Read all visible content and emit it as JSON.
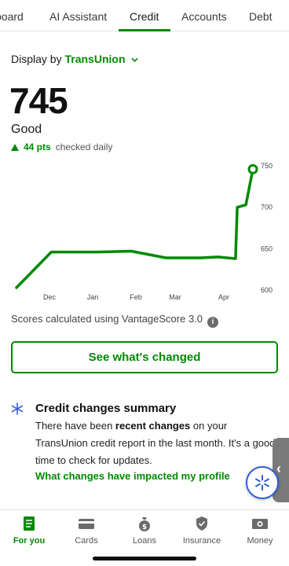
{
  "tabs": [
    {
      "label": "board"
    },
    {
      "label": "AI Assistant"
    },
    {
      "label": "Credit"
    },
    {
      "label": "Accounts"
    },
    {
      "label": "Debt"
    }
  ],
  "display": {
    "prefix": "Display by",
    "bureau": "TransUnion"
  },
  "score": {
    "value": "745",
    "rating": "Good",
    "change": "44 pts",
    "frequency": "checked daily"
  },
  "chart_data": {
    "type": "line",
    "series": [
      {
        "values": [
          [
            0,
            602
          ],
          [
            1,
            645
          ],
          [
            2.3,
            645
          ],
          [
            3.3,
            646
          ],
          [
            4.3,
            638
          ],
          [
            5.3,
            638
          ],
          [
            5.8,
            639
          ],
          [
            6.3,
            637
          ],
          [
            6.35,
            699
          ],
          [
            6.6,
            702
          ],
          [
            6.8,
            745
          ]
        ]
      }
    ],
    "x_ticks": [
      "Dec",
      "Jan",
      "Feb",
      "Mar",
      "Apr"
    ],
    "y_ticks": [
      "750",
      "700",
      "650",
      "600"
    ],
    "ylim": [
      600,
      750
    ],
    "color": "#008a00"
  },
  "vantage_note": "Scores calculated using VantageScore 3.0",
  "see_changed": "See what's changed",
  "summary": {
    "title": "Credit changes summary",
    "body_pre": "There have been ",
    "body_bold": "recent changes",
    "body_post": " on your TransUnion credit report in the last month. It's a good time to check for updates.",
    "link": "What changes have impacted my profile"
  },
  "bottom_nav": [
    {
      "label": "For you",
      "icon": "document-icon"
    },
    {
      "label": "Cards",
      "icon": "card-icon"
    },
    {
      "label": "Loans",
      "icon": "money-bag-icon"
    },
    {
      "label": "Insurance",
      "icon": "shield-icon"
    },
    {
      "label": "Money",
      "icon": "cash-icon"
    }
  ],
  "colors": {
    "accent": "#008a00",
    "assistant": "#2d5fd4"
  }
}
